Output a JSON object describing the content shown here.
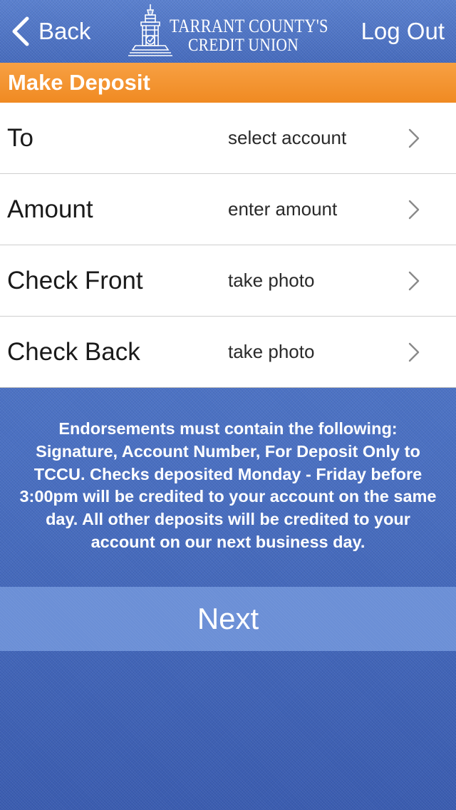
{
  "navbar": {
    "back_label": "Back",
    "logout_label": "Log Out",
    "logo": {
      "line1": "TARRANT COUNTY'S",
      "line2": "CREDIT UNION"
    }
  },
  "section": {
    "title": "Make Deposit"
  },
  "form": {
    "rows": [
      {
        "label": "To",
        "value": "select account"
      },
      {
        "label": "Amount",
        "value": "enter amount"
      },
      {
        "label": "Check Front",
        "value": "take photo"
      },
      {
        "label": "Check Back",
        "value": "take photo"
      }
    ]
  },
  "notice": {
    "text": "Endorsements must contain the following: Signature, Account Number, For Deposit Only to TCCU. Checks deposited Monday - Friday before 3:00pm will be credited to your account on the same day. All other deposits will be credited to your account on our next business day."
  },
  "next_label": "Next",
  "colors": {
    "nav_blue": "#4d74c6",
    "header_orange": "#f08a22",
    "next_button": "#6b8fd6",
    "background_blue": "#4a72c4"
  },
  "icons": {
    "back": "chevron-left-icon",
    "row_disclosure": "chevron-right-icon",
    "logo_emblem": "courthouse-icon"
  }
}
